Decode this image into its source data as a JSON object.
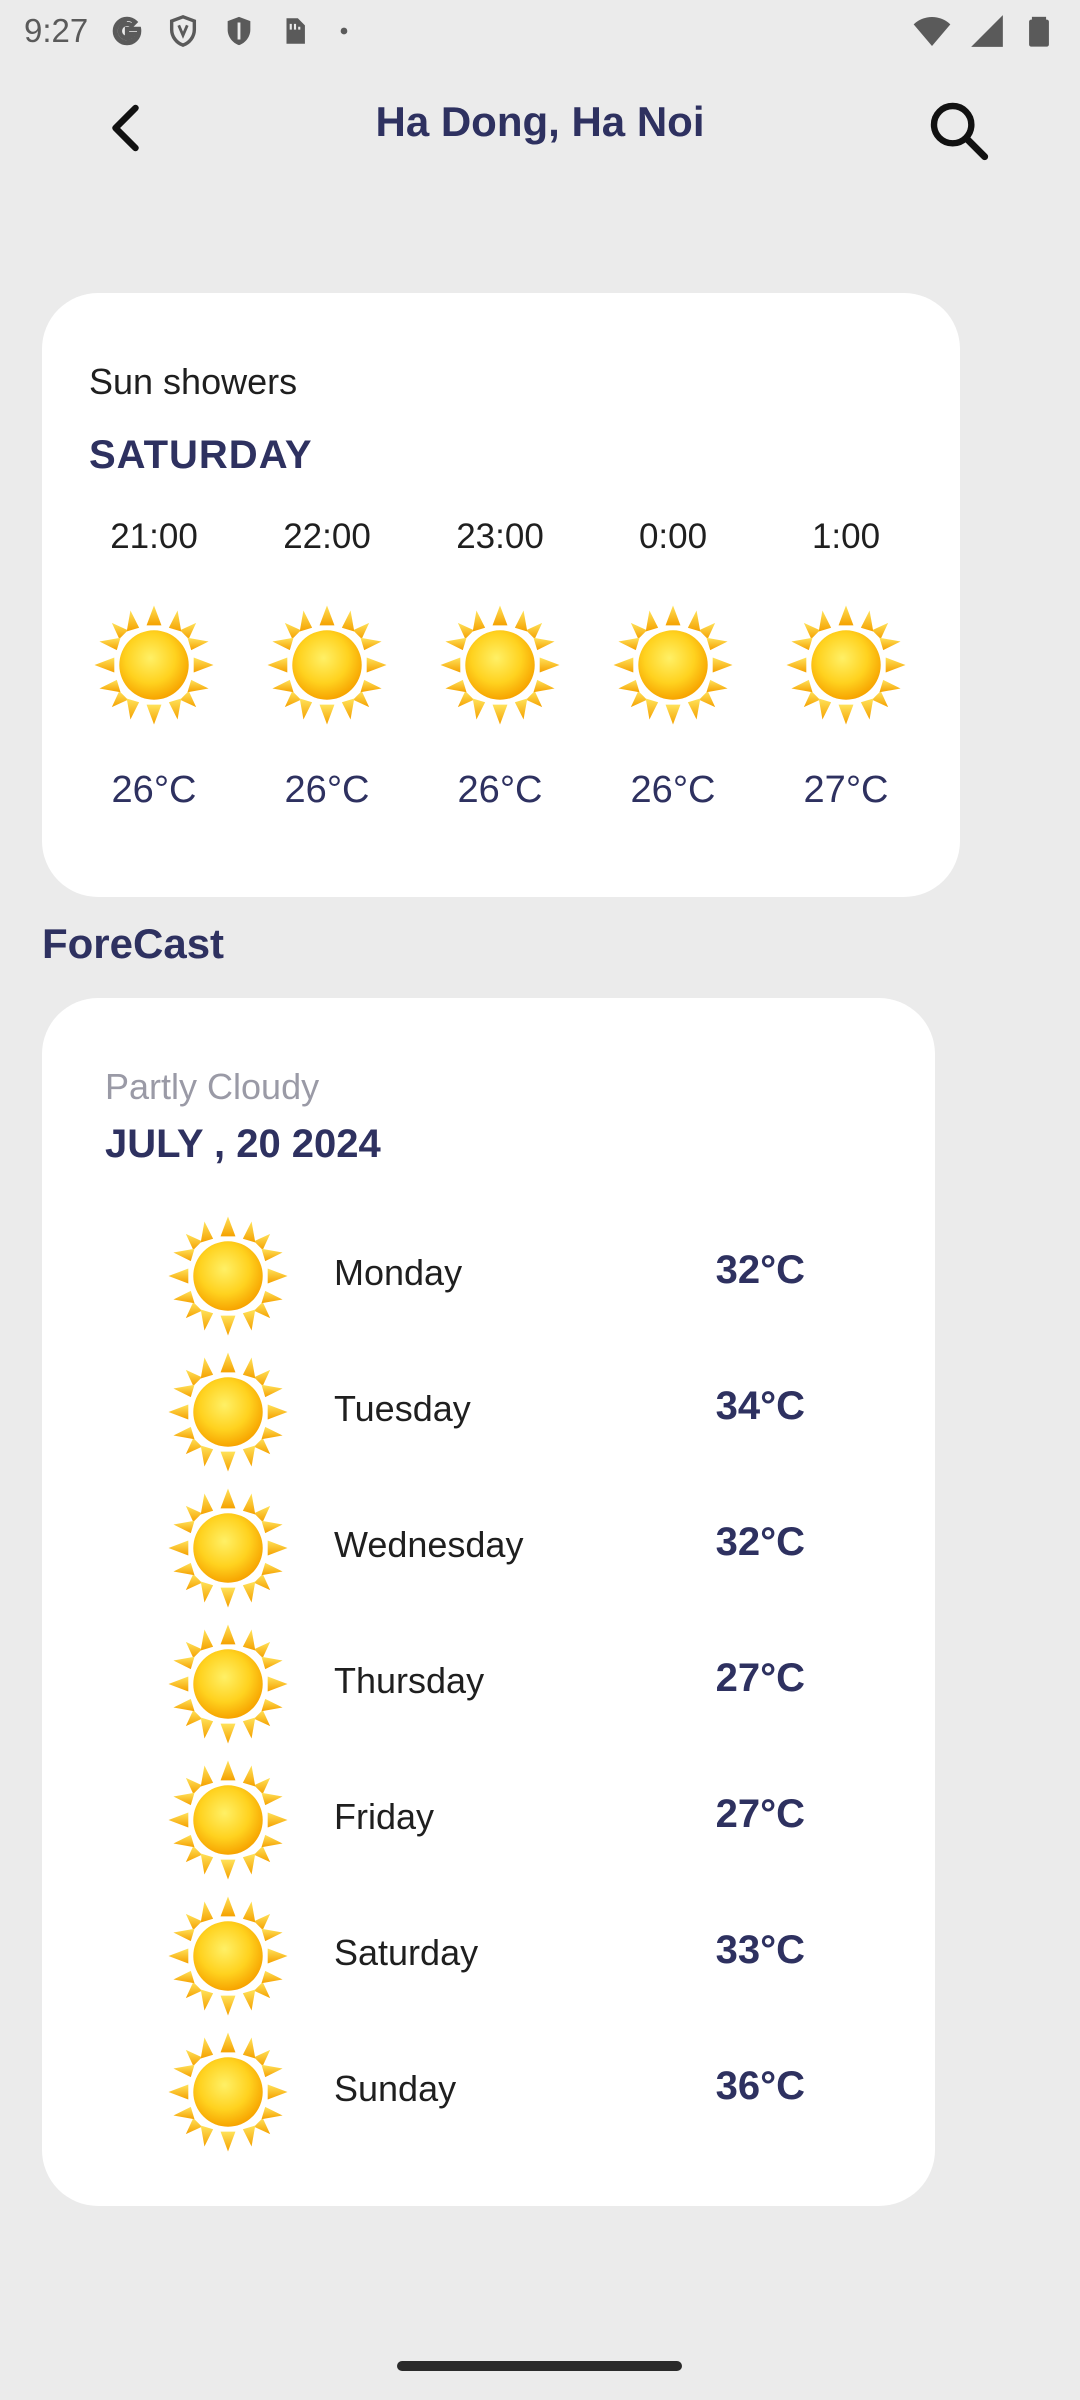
{
  "status_bar": {
    "time": "9:27",
    "icons": [
      "google-icon",
      "vpn-shield-icon",
      "shield-icon",
      "sim-card-icon",
      "dot-icon",
      "wifi-icon",
      "signal-icon",
      "battery-icon"
    ]
  },
  "header": {
    "title": "Ha Dong, Ha Noi",
    "back_icon": "chevron-left-icon",
    "search_icon": "search-icon"
  },
  "hourly": {
    "condition": "Sun showers",
    "day": "SATURDAY",
    "items": [
      {
        "time": "21:00",
        "temp": "26°C",
        "icon": "sun-icon"
      },
      {
        "time": "22:00",
        "temp": "26°C",
        "icon": "sun-icon"
      },
      {
        "time": "23:00",
        "temp": "26°C",
        "icon": "sun-icon"
      },
      {
        "time": "0:00",
        "temp": "26°C",
        "icon": "sun-icon"
      },
      {
        "time": "1:00",
        "temp": "27°C",
        "icon": "sun-icon"
      }
    ]
  },
  "forecast": {
    "section_title": "ForeCast",
    "condition": "Partly Cloudy",
    "date": "JULY , 20 2024",
    "days": [
      {
        "day": "Monday",
        "temp": "32°C",
        "icon": "sun-icon"
      },
      {
        "day": "Tuesday",
        "temp": "34°C",
        "icon": "sun-icon"
      },
      {
        "day": "Wednesday",
        "temp": "32°C",
        "icon": "sun-icon"
      },
      {
        "day": "Thursday",
        "temp": "27°C",
        "icon": "sun-icon"
      },
      {
        "day": "Friday",
        "temp": "27°C",
        "icon": "sun-icon"
      },
      {
        "day": "Saturday",
        "temp": "33°C",
        "icon": "sun-icon"
      },
      {
        "day": "Sunday",
        "temp": "36°C",
        "icon": "sun-icon"
      }
    ]
  },
  "colors": {
    "background": "#ebebeb",
    "card": "#ffffff",
    "accent": "#2e3160",
    "muted": "#9a9aa6",
    "sun": "#ffd21f"
  }
}
